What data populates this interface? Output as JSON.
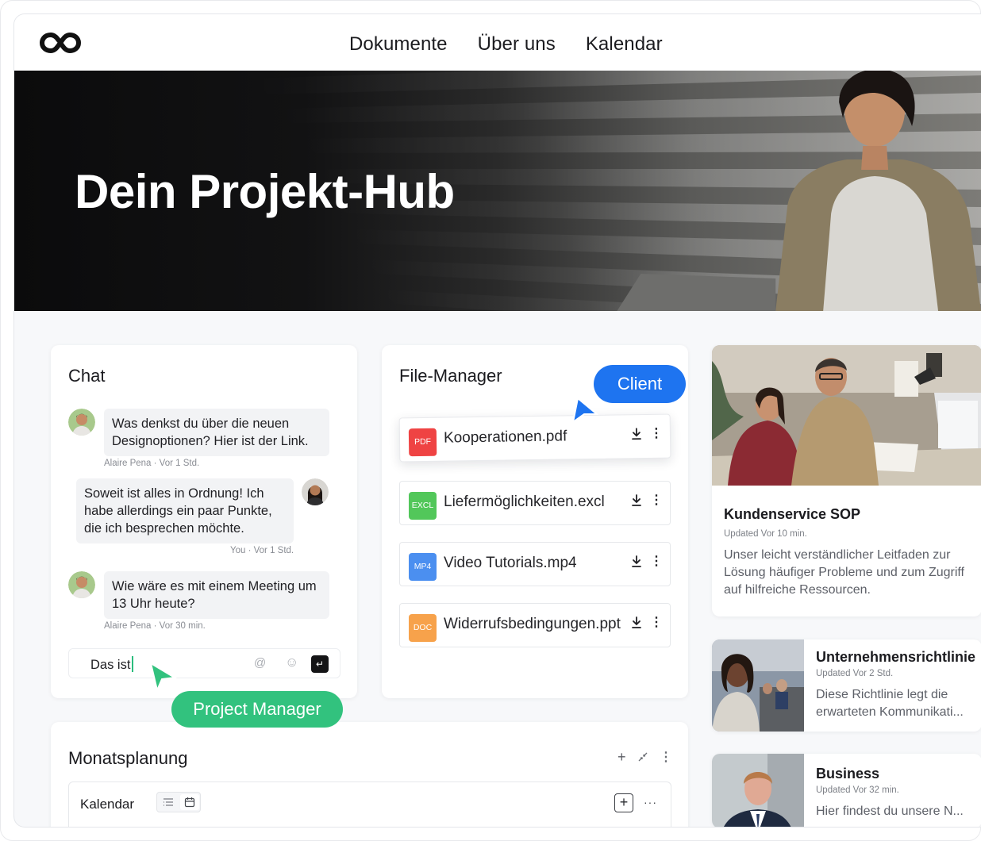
{
  "nav": {
    "logo_name": "infinity-logo",
    "links": [
      "Dokumente",
      "Über uns",
      "Kalendar"
    ]
  },
  "hero": {
    "title": "Dein Projekt-Hub"
  },
  "chat": {
    "title": "Chat",
    "messages": [
      {
        "text": "Was denkst du über die neuen Designoptionen? Hier ist der Link.",
        "meta": "Alaire Pena · Vor 1 Std."
      },
      {
        "text": "Soweit ist alles in Ordnung! Ich habe allerdings ein paar Punkte, die ich besprechen möchte.",
        "meta": "You · Vor 1 Std."
      },
      {
        "text": "Wie wäre es mit einem Meeting um 13 Uhr heute?",
        "meta": "Alaire Pena · Vor 30 min."
      }
    ],
    "input_value": "Das ist",
    "icons": {
      "mention": "@",
      "emoji": "☺",
      "send": "↵"
    }
  },
  "files": {
    "title": "File-Manager",
    "items": [
      {
        "badge": "PDF",
        "name": "Kooperationen.pdf",
        "color": "#ef4343"
      },
      {
        "badge": "EXCL",
        "name": "Liefermöglichkeiten.excl",
        "color": "#52c75a"
      },
      {
        "badge": "MP4",
        "name": "Video Tutorials.mp4",
        "color": "#4b8ff0"
      },
      {
        "badge": "DOC",
        "name": "Widerrufsbedingungen.ppt",
        "color": "#f7a24b"
      }
    ]
  },
  "cursors": {
    "client": "Client",
    "pm": "Project Manager"
  },
  "plan": {
    "title": "Monatsplanung",
    "sub_title": "Kalendar",
    "add": "+",
    "more": "···"
  },
  "articles": [
    {
      "title": "Kundenservice SOP",
      "updated": "Updated Vor 10 min.",
      "desc": "Unser leicht verständlicher Leitfaden zur Lösung häufiger Probleme und zum Zugriff auf hilfreiche Ressourcen."
    },
    {
      "title": "Unternehmensrichtlinie",
      "updated": "Updated Vor 2 Std.",
      "desc": "Diese Richtlinie legt die erwarteten Kommunikati..."
    },
    {
      "title": "Business",
      "updated": "Updated Vor 32 min.",
      "desc": "Hier findest du unsere N..."
    }
  ],
  "colors": {
    "accent_blue": "#1e74f0",
    "accent_green": "#32c27e",
    "hero_bg": "#0b0b0c"
  }
}
